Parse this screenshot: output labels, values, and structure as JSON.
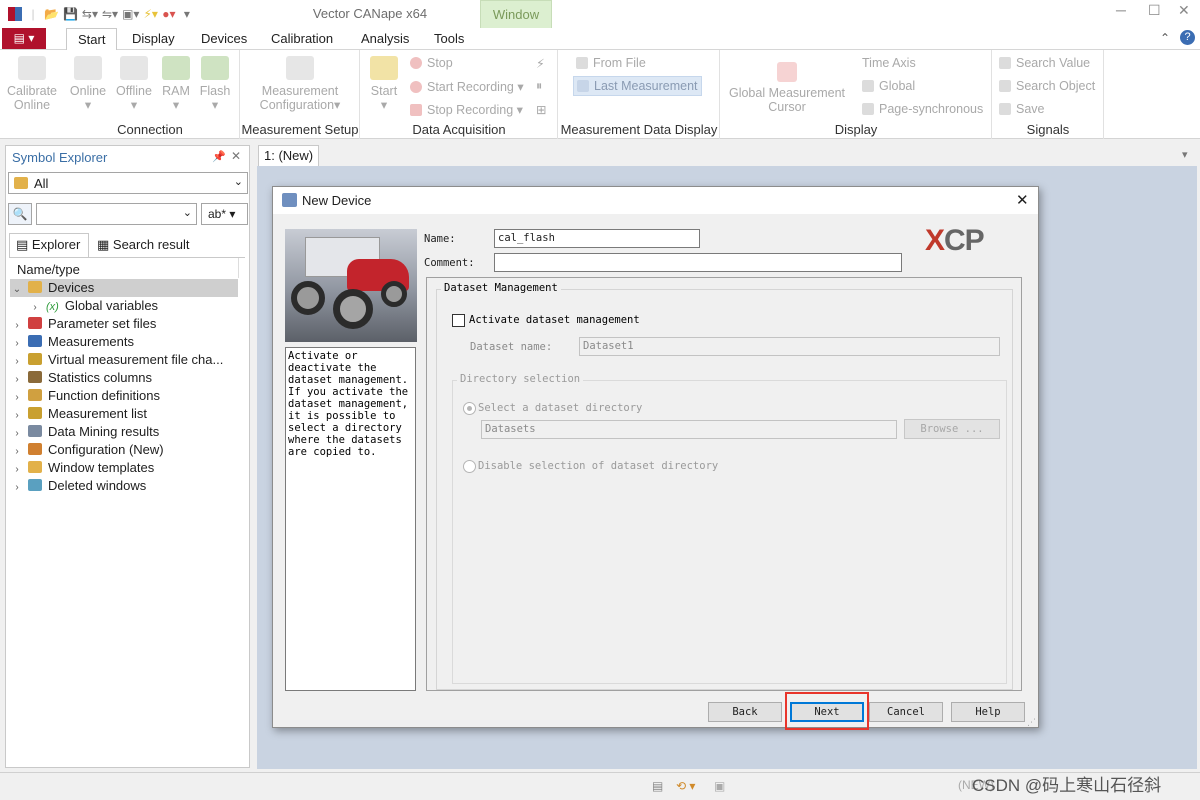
{
  "app": {
    "title": "Vector CANape x64",
    "window_tab": "Window"
  },
  "menu": {
    "tabs": [
      "Start",
      "Display",
      "Devices",
      "Calibration",
      "Analysis",
      "Tools"
    ]
  },
  "ribbon": {
    "connection": {
      "label": "Connection",
      "calibrate": "Calibrate Online",
      "online": "Online",
      "offline": "Offline",
      "ram": "RAM",
      "flash": "Flash"
    },
    "setup": {
      "label": "Measurement Setup",
      "config": "Measurement Configuration"
    },
    "acquisition": {
      "label": "Data Acquisition",
      "start": "Start",
      "stop": "Stop",
      "start_rec": "Start Recording",
      "stop_rec": "Stop Recording"
    },
    "mdd": {
      "label": "Measurement Data Display",
      "from_file": "From File",
      "last": "Last Measurement"
    },
    "display": {
      "label": "Display",
      "cursor": "Global Measurement Cursor",
      "time_axis": "Time Axis",
      "global": "Global",
      "page_sync": "Page-synchronous"
    },
    "signals": {
      "label": "Signals",
      "search_value": "Search Value",
      "search_object": "Search Object",
      "save": "Save"
    }
  },
  "explorer": {
    "title": "Symbol Explorer",
    "filter": "All",
    "match_btn": "ab*",
    "tabs": [
      "Explorer",
      "Search result"
    ],
    "column": "Name/type",
    "items": [
      {
        "label": "Devices",
        "icon": "devices-folder-icon"
      },
      {
        "label": "Global variables",
        "icon": "variable-icon"
      },
      {
        "label": "Parameter set files",
        "icon": "parameter-file-icon"
      },
      {
        "label": "Measurements",
        "icon": "measurement-icon"
      },
      {
        "label": "Virtual measurement file cha...",
        "icon": "virtual-file-icon"
      },
      {
        "label": "Statistics columns",
        "icon": "statistics-icon"
      },
      {
        "label": "Function definitions",
        "icon": "function-icon"
      },
      {
        "label": "Measurement list",
        "icon": "list-icon"
      },
      {
        "label": "Data Mining results",
        "icon": "data-mining-icon"
      },
      {
        "label": "Configuration (New)",
        "icon": "configuration-icon"
      },
      {
        "label": "Window templates",
        "icon": "window-template-icon"
      },
      {
        "label": "Deleted windows",
        "icon": "recycle-icon"
      }
    ]
  },
  "document": {
    "tab": "1: (New)"
  },
  "dialog": {
    "title": "New Device",
    "name_label": "Name:",
    "name_value": "cal_flash",
    "comment_label": "Comment:",
    "comment_value": "",
    "logo": "XCP",
    "help_text": "Activate or deactivate the dataset management. If you activate the dataset management, it is possible to select a directory where the datasets are copied to.",
    "group": "Dataset Management",
    "activate": "Activate dataset management",
    "dataset_name_label": "Dataset name:",
    "dataset_name_value": "Dataset1",
    "dir_group": "Directory selection",
    "select_dir": "Select a dataset directory",
    "dir_value": "Datasets",
    "browse": "Browse ...",
    "disable_dir": "Disable selection of dataset directory",
    "buttons": {
      "back": "Back",
      "next": "Next",
      "cancel": "Cancel",
      "help": "Help"
    }
  },
  "status": {
    "mode": "(NEW)",
    "watermark": "CSDN @码上寒山石径斜"
  },
  "colors": {
    "file_tab": "#b0112c",
    "window_tab": "#dcefd0",
    "highlight": "#e8352b",
    "doc_bg": "#c9d3e1"
  }
}
